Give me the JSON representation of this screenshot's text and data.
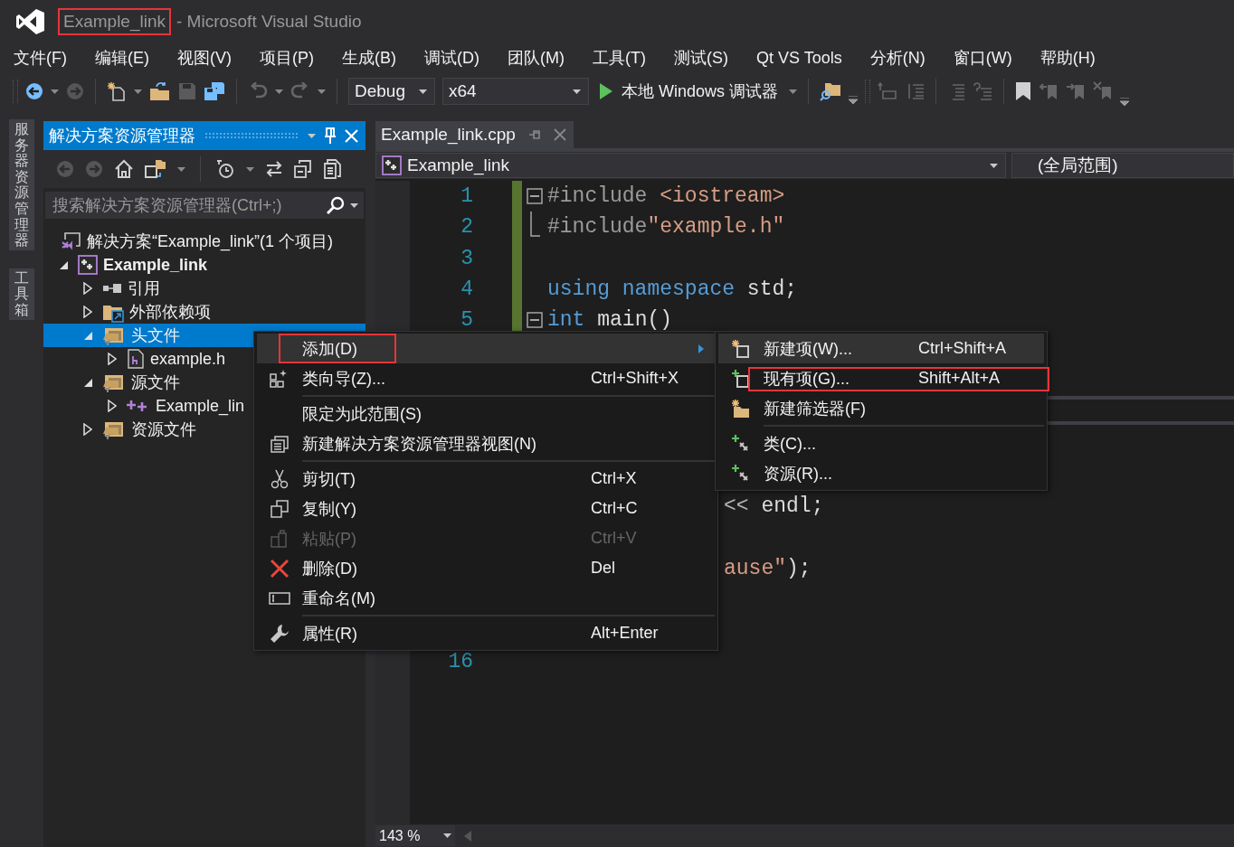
{
  "title": {
    "project": "Example_link",
    "rest": "- Microsoft Visual Studio",
    "annotated": true
  },
  "menu_bar": [
    "文件(F)",
    "编辑(E)",
    "视图(V)",
    "项目(P)",
    "生成(B)",
    "调试(D)",
    "团队(M)",
    "工具(T)",
    "测试(S)",
    "Qt VS Tools",
    "分析(N)",
    "窗口(W)",
    "帮助(H)"
  ],
  "toolbar": {
    "configuration": "Debug",
    "platform": "x64",
    "run": "本地 Windows 调试器"
  },
  "side_tabs": [
    "服务器资源管理器",
    "工具箱"
  ],
  "solution_explorer": {
    "title": "解决方案资源管理器",
    "search": {
      "placeholder": "搜索解决方案资源管理器(Ctrl+;)"
    },
    "tree": {
      "label": "解决方案“Example_link”(1 个项目)",
      "kind": "solution",
      "selected": false,
      "children": [
        {
          "label": "Example_link",
          "kind": "project",
          "bold": true,
          "expanded": true,
          "selected": false,
          "children": [
            {
              "label": "引用",
              "kind": "references",
              "expanded": false,
              "selected": false
            },
            {
              "label": "外部依赖项",
              "kind": "dependencies",
              "expanded": false,
              "selected": false
            },
            {
              "label": "头文件",
              "kind": "filter",
              "expanded": true,
              "selected": true,
              "children": [
                {
                  "label": "example.h",
                  "kind": "header",
                  "expanded": false,
                  "selected": false
                }
              ]
            },
            {
              "label": "源文件",
              "kind": "filter",
              "expanded": true,
              "selected": false,
              "children": [
                {
                  "label": "Example_lin",
                  "kind": "cpp",
                  "expanded": false,
                  "selected": false
                }
              ]
            },
            {
              "label": "资源文件",
              "kind": "filter",
              "expanded": false,
              "selected": false
            }
          ]
        }
      ]
    }
  },
  "editor": {
    "tab": "Example_link.cpp",
    "nav": {
      "scope": "Example_link",
      "member": "(全局范围)"
    },
    "lines": [
      {
        "kind": "line",
        "number": "1",
        "foldable": true,
        "fold_end": false,
        "changed": true,
        "tokens": [
          {
            "kind": "directive",
            "text": "#include"
          },
          {
            "kind": "header",
            "text": " <iostream>"
          }
        ]
      },
      {
        "kind": "line",
        "number": "2",
        "foldable": false,
        "fold_end": true,
        "changed": true,
        "tokens": [
          {
            "kind": "directive",
            "text": "#include"
          },
          {
            "kind": "header",
            "text": "\"example.h\""
          }
        ]
      },
      {
        "kind": "line",
        "number": "3",
        "foldable": false,
        "fold_end": false,
        "changed": true
      },
      {
        "kind": "line",
        "number": "4",
        "foldable": false,
        "fold_end": false,
        "changed": true,
        "tokens": [
          {
            "kind": "keyword",
            "text": "using namespace"
          },
          {
            "kind": "plain",
            "text": " std;"
          }
        ]
      },
      {
        "kind": "line",
        "number": "5",
        "foldable": true,
        "fold_end": false,
        "changed": true,
        "tokens": [
          {
            "kind": "keyword",
            "text": "int"
          },
          {
            "kind": "plain",
            "text": " main()"
          }
        ]
      },
      {
        "kind": "covered"
      },
      {
        "kind": "covered"
      },
      {
        "kind": "covered"
      },
      {
        "kind": "covered"
      },
      {
        "kind": "covered"
      },
      {
        "kind": "partial",
        "tokens": [
          {
            "kind": "operator",
            "text": "<< "
          },
          {
            "kind": "plain",
            "text": "endl;"
          }
        ]
      },
      {
        "kind": "covered"
      },
      {
        "kind": "partial",
        "tokens": [
          {
            "kind": "header",
            "text": "ause\""
          },
          {
            "kind": "plain",
            "text": ");"
          }
        ]
      },
      {
        "kind": "covered"
      },
      {
        "kind": "covered"
      },
      {
        "kind": "line",
        "number": "16",
        "foldable": false,
        "fold_end": false,
        "changed": false
      }
    ],
    "zoom": "143 %"
  },
  "context_menu": {
    "items": [
      {
        "kind": "plain",
        "label": "添加(D)",
        "submenu": true,
        "disabled": false,
        "selected": true,
        "annotated": true
      },
      {
        "kind": "wizard",
        "label": "类向导(Z)...",
        "shortcut": "Ctrl+Shift+X",
        "disabled": false,
        "selected": false
      },
      {
        "kind": "separator"
      },
      {
        "kind": "plain",
        "label": "限定为此范围(S)",
        "disabled": false,
        "selected": false
      },
      {
        "kind": "new-view",
        "label": "新建解决方案资源管理器视图(N)",
        "disabled": false,
        "selected": false
      },
      {
        "kind": "separator"
      },
      {
        "kind": "cut",
        "label": "剪切(T)",
        "shortcut": "Ctrl+X",
        "disabled": false,
        "selected": false
      },
      {
        "kind": "copy",
        "label": "复制(Y)",
        "shortcut": "Ctrl+C",
        "disabled": false,
        "selected": false
      },
      {
        "kind": "paste",
        "label": "粘贴(P)",
        "shortcut": "Ctrl+V",
        "disabled": true,
        "selected": false
      },
      {
        "kind": "delete",
        "label": "删除(D)",
        "shortcut": "Del",
        "disabled": false,
        "selected": false
      },
      {
        "kind": "rename",
        "label": "重命名(M)",
        "disabled": false,
        "selected": false
      },
      {
        "kind": "separator"
      },
      {
        "kind": "properties",
        "label": "属性(R)",
        "shortcut": "Alt+Enter",
        "disabled": false,
        "selected": false
      }
    ]
  },
  "submenu": {
    "items": [
      {
        "kind": "new-item",
        "label": "新建项(W)...",
        "shortcut": "Ctrl+Shift+A",
        "disabled": false,
        "selected": true
      },
      {
        "kind": "existing-item",
        "label": "现有项(G)...",
        "shortcut": "Shift+Alt+A",
        "disabled": false,
        "selected": false,
        "annotated": true
      },
      {
        "kind": "new-filter",
        "label": "新建筛选器(F)",
        "disabled": false,
        "selected": false
      },
      {
        "kind": "separator"
      },
      {
        "kind": "class",
        "label": "类(C)...",
        "disabled": false,
        "selected": false
      },
      {
        "kind": "class",
        "label": "资源(R)...",
        "disabled": false,
        "selected": false
      }
    ]
  }
}
